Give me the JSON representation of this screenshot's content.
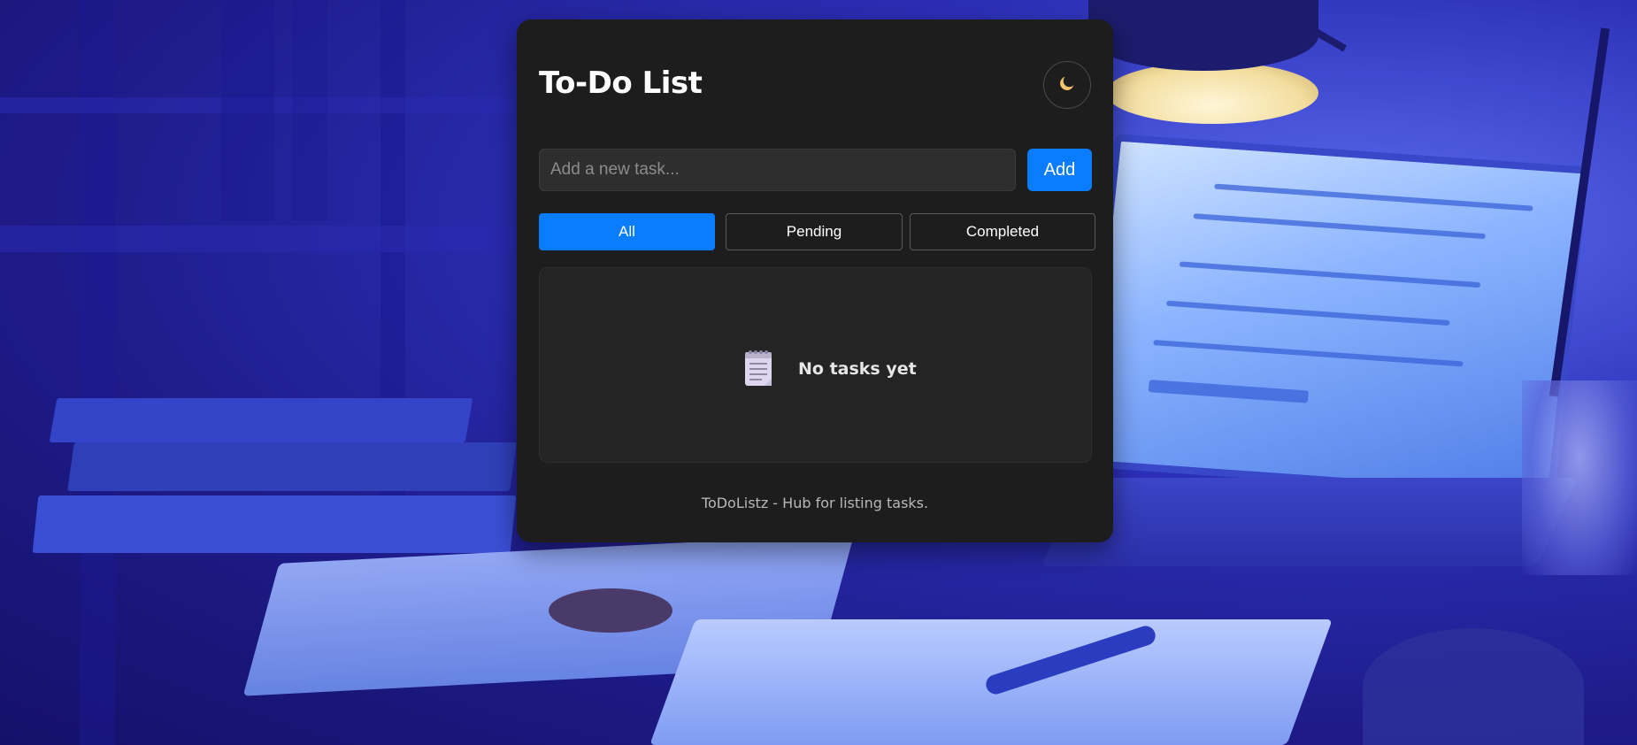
{
  "app": {
    "title": "To-Do List",
    "theme_toggle_icon": "crescent-moon-icon"
  },
  "input": {
    "placeholder": "Add a new task...",
    "value": ""
  },
  "add_button": {
    "label": "Add"
  },
  "filters": {
    "items": [
      {
        "label": "All",
        "active": true
      },
      {
        "label": "Pending",
        "active": false
      },
      {
        "label": "Completed",
        "active": false
      }
    ]
  },
  "task_list": {
    "empty_icon": "notepad-icon",
    "empty_text": "No tasks yet"
  },
  "footer": {
    "text": "ToDoListz - Hub for listing tasks."
  },
  "colors": {
    "accent": "#0a7cff",
    "card_bg": "#1d1d1d",
    "moon": "#f5c46a"
  }
}
